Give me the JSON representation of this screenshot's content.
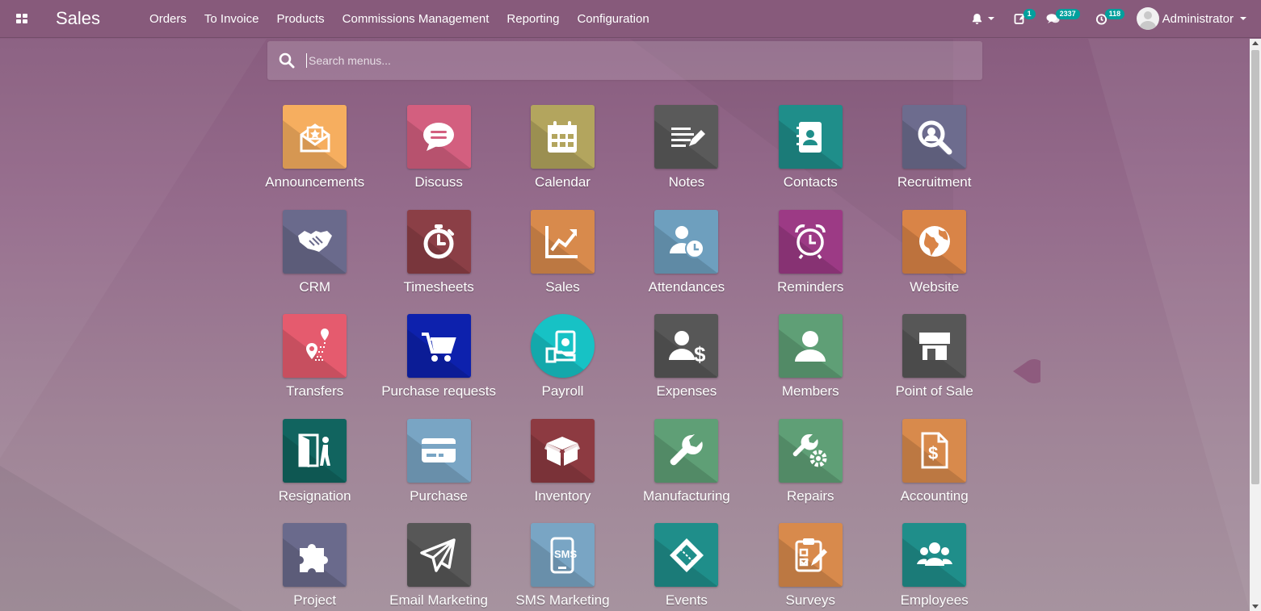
{
  "navbar": {
    "app_title": "Sales",
    "menu": [
      "Orders",
      "To Invoice",
      "Products",
      "Commissions Management",
      "Reporting",
      "Configuration"
    ],
    "activities_badge": "1",
    "messages_badge": "2337",
    "timer_badge": "118",
    "user_name": "Administrator"
  },
  "search": {
    "placeholder": "Search menus..."
  },
  "apps": [
    {
      "label": "Announcements",
      "color": "#f6ae5f",
      "icon": "envelope-star-icon"
    },
    {
      "label": "Discuss",
      "color": "#d35f7f",
      "icon": "chat-bubble-icon"
    },
    {
      "label": "Calendar",
      "color": "#b3a55e",
      "icon": "calendar-icon"
    },
    {
      "label": "Notes",
      "color": "#5a5a5a",
      "icon": "notes-pencil-icon"
    },
    {
      "label": "Contacts",
      "color": "#1f8e8a",
      "icon": "address-book-icon"
    },
    {
      "label": "Recruitment",
      "color": "#6d6c8e",
      "icon": "magnifier-user-icon"
    },
    {
      "label": "CRM",
      "color": "#6a6a8c",
      "icon": "handshake-icon"
    },
    {
      "label": "Timesheets",
      "color": "#8b3f46",
      "icon": "stopwatch-icon"
    },
    {
      "label": "Sales",
      "color": "#d88a4c",
      "icon": "trend-chart-icon"
    },
    {
      "label": "Attendances",
      "color": "#6e9fbe",
      "icon": "user-clock-icon"
    },
    {
      "label": "Reminders",
      "color": "#9c3a85",
      "icon": "alarm-clock-icon"
    },
    {
      "label": "Website",
      "color": "#d98447",
      "icon": "globe-icon"
    },
    {
      "label": "Transfers",
      "color": "#e55b6e",
      "icon": "route-pin-icon"
    },
    {
      "label": "Purchase requests",
      "color": "#0d21ad",
      "icon": "shopping-cart-icon"
    },
    {
      "label": "Payroll",
      "color": "#17c2c5",
      "icon": "money-hand-icon"
    },
    {
      "label": "Expenses",
      "color": "#575757",
      "icon": "user-dollar-icon"
    },
    {
      "label": "Members",
      "color": "#5f9f76",
      "icon": "user-icon"
    },
    {
      "label": "Point of Sale",
      "color": "#575757",
      "icon": "shop-icon"
    },
    {
      "label": "Resignation",
      "color": "#11645f",
      "icon": "exit-door-icon"
    },
    {
      "label": "Purchase",
      "color": "#79a5c4",
      "icon": "credit-card-icon"
    },
    {
      "label": "Inventory",
      "color": "#8d3a41",
      "icon": "box-icon"
    },
    {
      "label": "Manufacturing",
      "color": "#5f9f76",
      "icon": "wrench-icon"
    },
    {
      "label": "Repairs",
      "color": "#5f9f76",
      "icon": "wrench-gear-icon"
    },
    {
      "label": "Accounting",
      "color": "#d88a4c",
      "icon": "invoice-dollar-icon"
    },
    {
      "label": "Project",
      "color": "#6a6a8c",
      "icon": "puzzle-icon"
    },
    {
      "label": "Email Marketing",
      "color": "#575757",
      "icon": "paper-plane-icon"
    },
    {
      "label": "SMS Marketing",
      "color": "#79a5c4",
      "icon": "sms-phone-icon"
    },
    {
      "label": "Events",
      "color": "#1f8e8a",
      "icon": "ticket-icon"
    },
    {
      "label": "Surveys",
      "color": "#d88a4c",
      "icon": "clipboard-check-icon"
    },
    {
      "label": "Employees",
      "color": "#1f8e8a",
      "icon": "users-group-icon"
    }
  ]
}
